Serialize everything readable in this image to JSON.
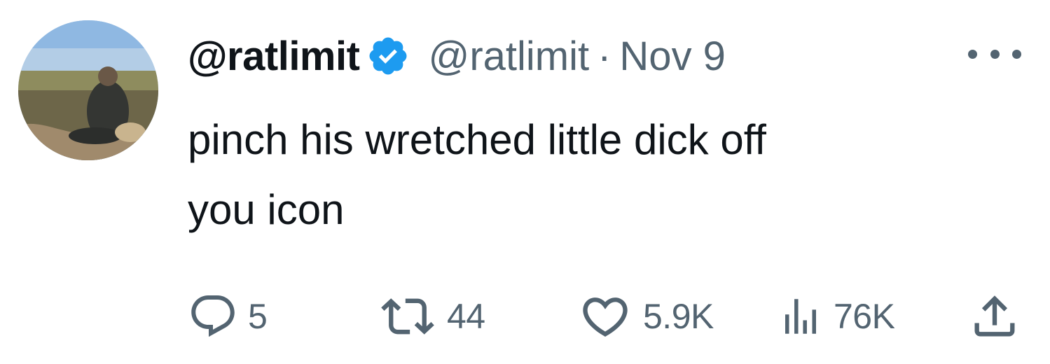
{
  "tweet": {
    "display_name": "@ratlimit",
    "handle": "@ratlimit",
    "separator": "·",
    "date": "Nov 9",
    "text": "pinch his wretched little dick off\nyou icon",
    "verified": true
  },
  "actions": {
    "replies": "5",
    "retweets": "44",
    "likes": "5.9K",
    "views": "76K"
  },
  "colors": {
    "text": "#0f1419",
    "secondary": "#536471",
    "verified_badge": "#1d9bf0"
  },
  "icons": [
    "reply-icon",
    "retweet-icon",
    "like-icon",
    "views-icon",
    "share-icon",
    "more-icon",
    "verified-icon"
  ]
}
